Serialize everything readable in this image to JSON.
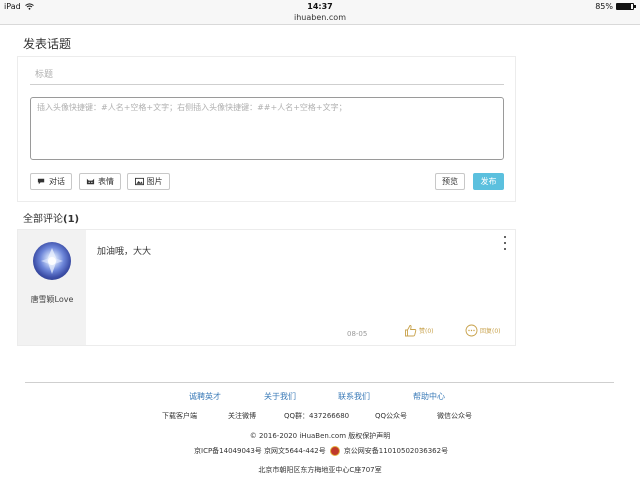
{
  "status_bar": {
    "device": "iPad",
    "time": "14:37",
    "battery_text": "85%",
    "battery_level": 0.85,
    "url": "ihuaben.com"
  },
  "composer": {
    "heading": "发表话题",
    "title_placeholder": "标题",
    "body_placeholder": "插入头像快捷键：#人名+空格+文字；右侧插入头像快捷键：##+人名+空格+文字；",
    "tools": [
      "对话",
      "表情",
      "图片"
    ],
    "preview_label": "预览",
    "publish_label": "发布"
  },
  "comments": {
    "heading_label": "全部评论",
    "count": "(1)",
    "items": [
      {
        "author": "唐雪颖Love",
        "text": "加油哦，大大",
        "date": "08-05",
        "like_label": "赞(0)",
        "reply_label": "回复(0)"
      }
    ]
  },
  "footer": {
    "links": [
      "诚聘英才",
      "关于我们",
      "联系我们",
      "帮助中心"
    ],
    "row2": [
      "下载客户端",
      "关注微博",
      "QQ群：437266680",
      "QQ公众号",
      "微信公众号"
    ],
    "copyright": "© 2016-2020 iHuaBen.com 版权保护声明",
    "icp": "京ICP备14049043号 京网文5644-442号",
    "police": "京公网安备11010502036362号",
    "address": "北京市朝阳区东方梅地亚中心C座707室"
  },
  "colors": {
    "accent": "#5bc0de",
    "link": "#3b7bb8",
    "like": "#c8a24c"
  }
}
